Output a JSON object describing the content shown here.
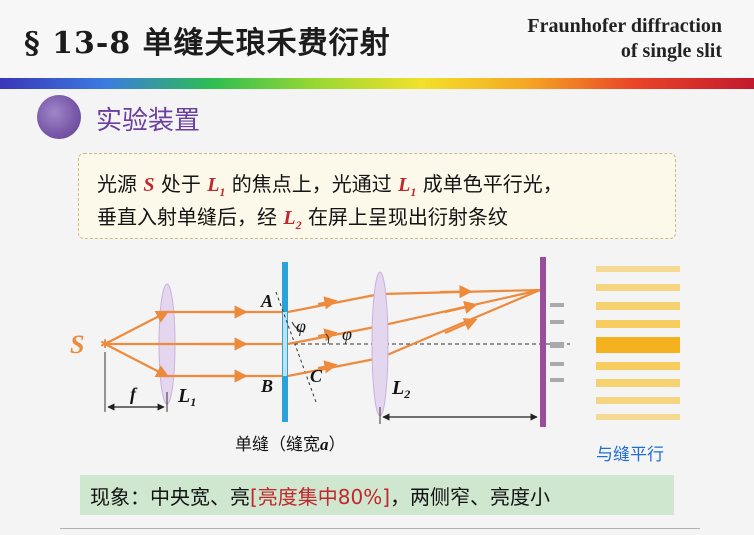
{
  "header": {
    "title": "§ 13-8 单缝夫琅禾费衍射",
    "en_line1": "Fraunhofer diffraction",
    "en_line2": "of single slit"
  },
  "section": {
    "title": "实验装置"
  },
  "description": {
    "line1": [
      "光源",
      "S",
      "处于",
      "L",
      "1",
      "的焦点上，光通过",
      "L",
      "1",
      "成单色平行光，"
    ],
    "line2": [
      "垂直入射单缝后，经",
      "L",
      "2",
      "在屏上呈现出衍射条纹"
    ]
  },
  "diagram": {
    "source_label": "S",
    "focal_label": "f",
    "lens1_label": "L",
    "lens1_sub": "1",
    "lens2_label": "L",
    "lens2_sub": "2",
    "point_a": "A",
    "point_b": "B",
    "point_c": "C",
    "angle_label": "φ",
    "angle_label2": "φ",
    "slit_caption": "单缝（缝宽",
    "slit_var": "a",
    "slit_close": "）",
    "fringe_caption": "与缝平行",
    "colors": {
      "ray": "#ee8a3c",
      "slit": "#2ba3d8",
      "screen": "#9b4d9d",
      "lens": "#d9c7e6",
      "fringe": "#f7c544"
    }
  },
  "phenomenon": {
    "prefix": "现象：中央宽、亮",
    "highlight": "[亮度集中80%]",
    "suffix": "，两侧窄、亮度小"
  }
}
